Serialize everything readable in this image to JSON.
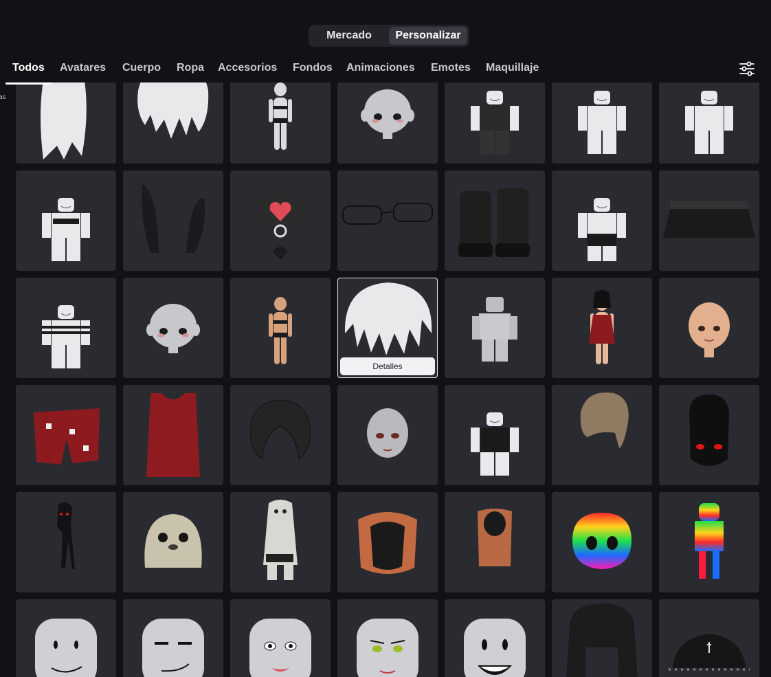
{
  "segment": {
    "left_label": "Mercado",
    "right_label": "Personalizar"
  },
  "tabs": [
    {
      "label": "Todos",
      "active": true
    },
    {
      "label": "Avatares"
    },
    {
      "label": "Cuerpo"
    },
    {
      "label": "Ropa"
    },
    {
      "label": "Accesorios"
    },
    {
      "label": "Fondos"
    },
    {
      "label": "Animaciones"
    },
    {
      "label": "Emotes"
    },
    {
      "label": "Maquillaje"
    }
  ],
  "edge_text": "as",
  "filter_icon": "sliders-icon",
  "details_label": "Detalles",
  "colors": {
    "background": "#111216",
    "tile": "#2a2b31",
    "accent": "#ffffff"
  },
  "items": [
    "long-white-hair",
    "white-messy-hair",
    "white-bikini-body",
    "gray-blush-head",
    "black-vest-outfit",
    "white-shirt-outfit",
    "white-shirt-outfit-2",
    "bikini-top-outfit",
    "black-bunny-ears",
    "heart-choker",
    "thin-glasses",
    "black-platform-boots",
    "striped-skirt-outfit",
    "studded-black-skirt",
    "striped-crop-outfit",
    "gray-blush-head-2",
    "tan-bikini-body",
    "white-fluffy-hair",
    "gray-blocky-avatar",
    "red-dress-avatar",
    "bald-skin-head",
    "red-boxer-shorts",
    "red-tank-top",
    "black-messy-hair",
    "gray-doll-head",
    "black-shirt-outfit",
    "brown-bun-hair",
    "black-red-eye-head",
    "tall-shadow-creature",
    "seal-head",
    "seal-costume",
    "capybara-head",
    "capybara-body",
    "rainbow-head",
    "rainbow-body",
    "smile-face",
    "smirk-face",
    "lipstick-face",
    "lashes-face",
    "grin-face",
    "black-pigtail-hair",
    "black-studded-cap"
  ]
}
